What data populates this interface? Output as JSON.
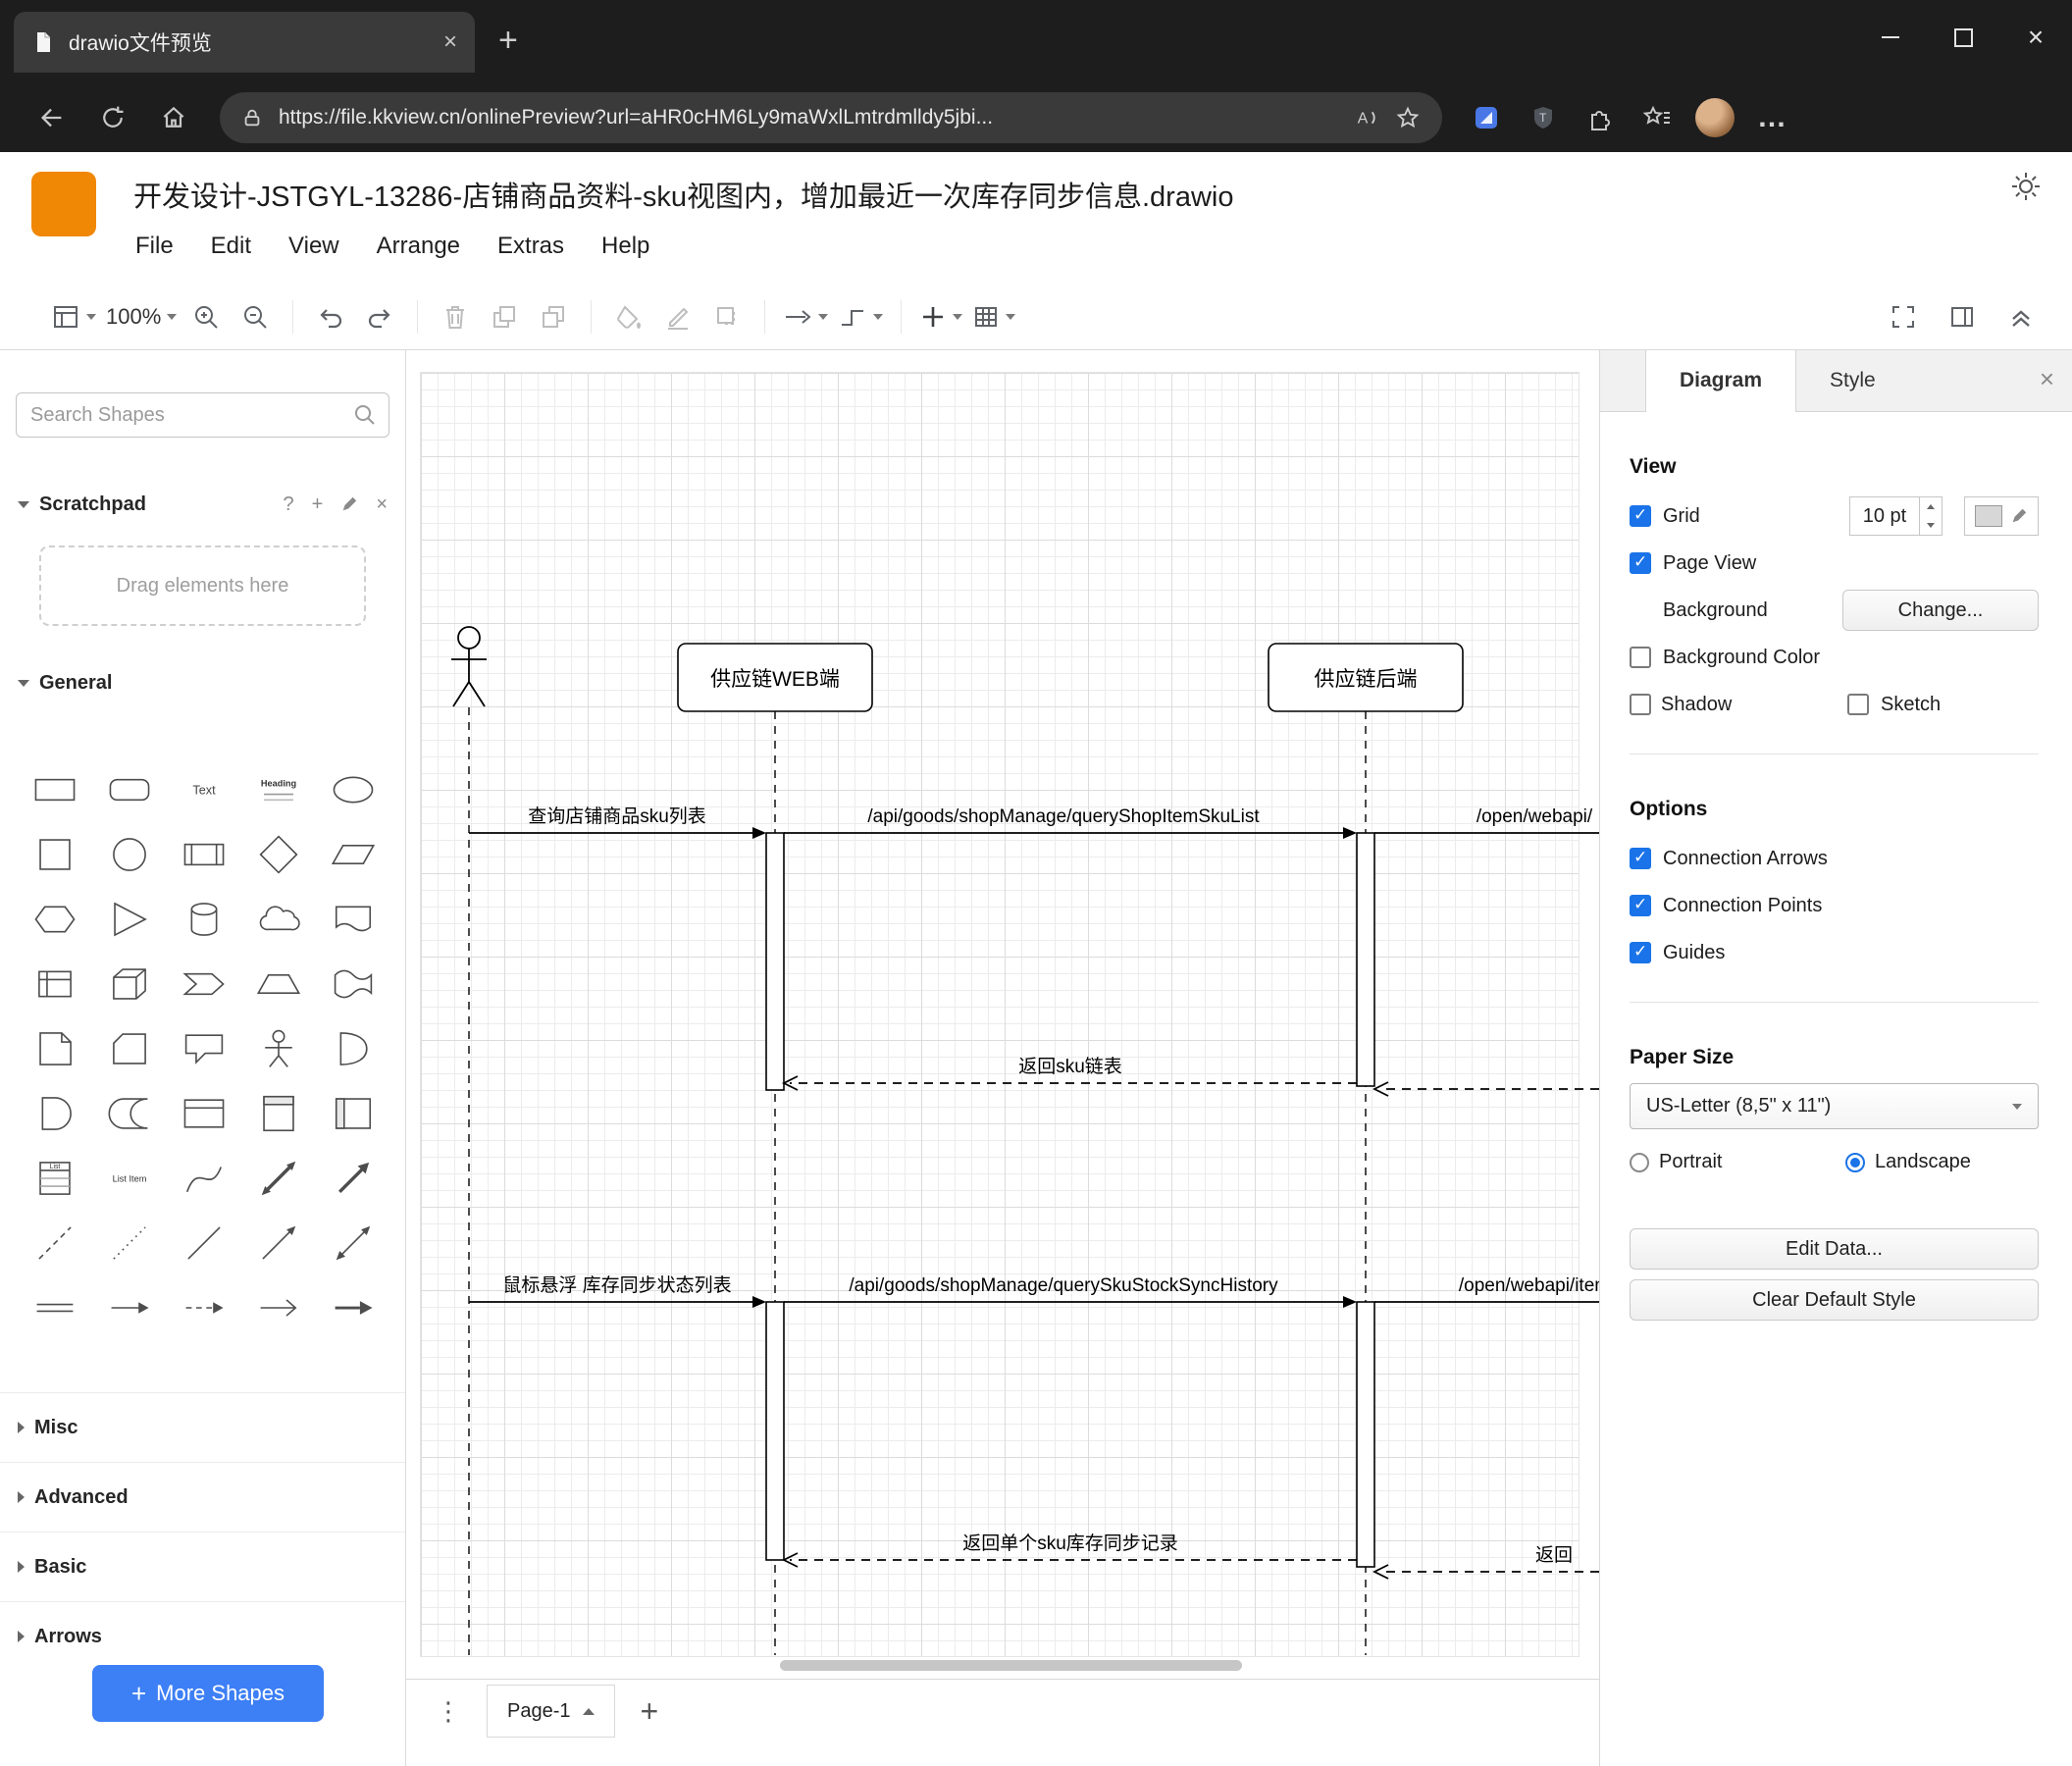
{
  "colors": {
    "accent_blue": "#1a73e8",
    "logo_orange": "#f08705",
    "more_shapes_blue": "#3d7ff5"
  },
  "browser": {
    "tab_title": "drawio文件预览",
    "url": "https://file.kkview.cn/onlinePreview?url=aHR0cHM6Ly9maWxlLmtrdmlldy5jbi..."
  },
  "app": {
    "title": "开发设计-JSTGYL-13286-店铺商品资料-sku视图内，增加最近一次库存同步信息.drawio",
    "menus": [
      "File",
      "Edit",
      "View",
      "Arrange",
      "Extras",
      "Help"
    ],
    "zoom": "100%"
  },
  "sidebar": {
    "search_placeholder": "Search Shapes",
    "scratchpad_title": "Scratchpad",
    "drag_hint": "Drag elements here",
    "sections": {
      "general": "General",
      "misc": "Misc",
      "advanced": "Advanced",
      "basic": "Basic",
      "arrows": "Arrows"
    },
    "more_shapes": "More Shapes",
    "shape_labels": {
      "text": "Text",
      "heading": "Heading",
      "list": "List",
      "list_item": "List Item"
    },
    "shapes": [
      "rectangle",
      "rounded-rectangle",
      "text",
      "heading",
      "ellipse",
      "square",
      "circle",
      "process",
      "diamond",
      "parallelogram",
      "hexagon",
      "triangle",
      "cylinder",
      "cloud",
      "document",
      "internal-storage",
      "cube",
      "step",
      "trapezoid",
      "tape",
      "note",
      "card",
      "callout",
      "actor",
      "or",
      "and",
      "data-storage",
      "container",
      "vertical-container",
      "horizontal-container",
      "list",
      "list-item",
      "curve",
      "bidirectional-arrow",
      "arrow",
      "dashed-line",
      "dotted-line",
      "line",
      "directional-connector",
      "bidirectional-connector",
      "link",
      "directional-edge",
      "dashed-edge",
      "arrow-edge",
      "filled-arrow-edge"
    ]
  },
  "canvas": {
    "lifelines": [
      {
        "label": "供应链WEB端"
      },
      {
        "label": "供应链后端"
      }
    ],
    "messages": {
      "m1": "查询店铺商品sku列表",
      "m2": "/api/goods/shopManage/queryShopItemSkuList",
      "m3": "/open/webapi/",
      "r1": "返回sku链表",
      "m4": "鼠标悬浮 库存同步状态列表",
      "m5": "/api/goods/shopManage/querySkuStockSyncHistory",
      "m6": "/open/webapi/item",
      "r2": "返回单个sku库存同步记录",
      "r3": "返回"
    }
  },
  "footer": {
    "page_tab": "Page-1"
  },
  "format_panel": {
    "tabs": {
      "diagram": "Diagram",
      "style": "Style"
    },
    "view": {
      "heading": "View",
      "grid_label": "Grid",
      "grid_checked": true,
      "grid_size": "10 pt",
      "page_view_label": "Page View",
      "page_view_checked": true,
      "background_label": "Background",
      "change_button": "Change...",
      "background_color_label": "Background Color",
      "background_color_checked": false,
      "shadow_label": "Shadow",
      "shadow_checked": false,
      "sketch_label": "Sketch",
      "sketch_checked": false
    },
    "options": {
      "heading": "Options",
      "items": [
        {
          "label": "Connection Arrows",
          "checked": true
        },
        {
          "label": "Connection Points",
          "checked": true
        },
        {
          "label": "Guides",
          "checked": true
        }
      ]
    },
    "paper": {
      "heading": "Paper Size",
      "selected": "US-Letter (8,5\" x 11\")",
      "portrait": "Portrait",
      "portrait_on": false,
      "landscape": "Landscape",
      "landscape_on": true
    },
    "buttons": {
      "edit_data": "Edit Data...",
      "clear_default_style": "Clear Default Style"
    }
  }
}
